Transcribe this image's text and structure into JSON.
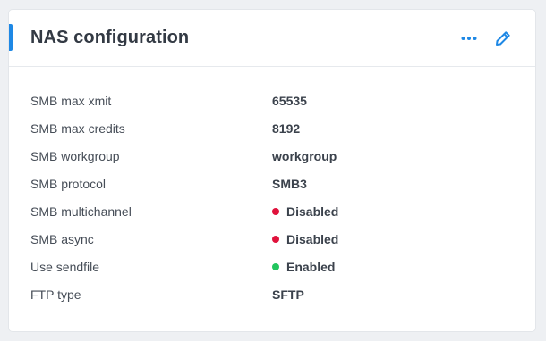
{
  "card": {
    "title": "NAS configuration",
    "accent_color": "#1e88e5",
    "actions": [
      {
        "name": "more-options",
        "icon": "ellipsis-icon"
      },
      {
        "name": "edit",
        "icon": "pencil-icon"
      }
    ]
  },
  "rows": [
    {
      "label": "SMB max xmit",
      "value": "65535",
      "status": null
    },
    {
      "label": "SMB max credits",
      "value": "8192",
      "status": null
    },
    {
      "label": "SMB workgroup",
      "value": "workgroup",
      "status": null
    },
    {
      "label": "SMB protocol",
      "value": "SMB3",
      "status": null
    },
    {
      "label": "SMB multichannel",
      "value": "Disabled",
      "status": "disabled"
    },
    {
      "label": "SMB async",
      "value": "Disabled",
      "status": "disabled"
    },
    {
      "label": "Use sendfile",
      "value": "Enabled",
      "status": "enabled"
    },
    {
      "label": "FTP type",
      "value": "SFTP",
      "status": null
    }
  ],
  "status_colors": {
    "enabled": "#22c55e",
    "disabled": "#e0123c"
  }
}
